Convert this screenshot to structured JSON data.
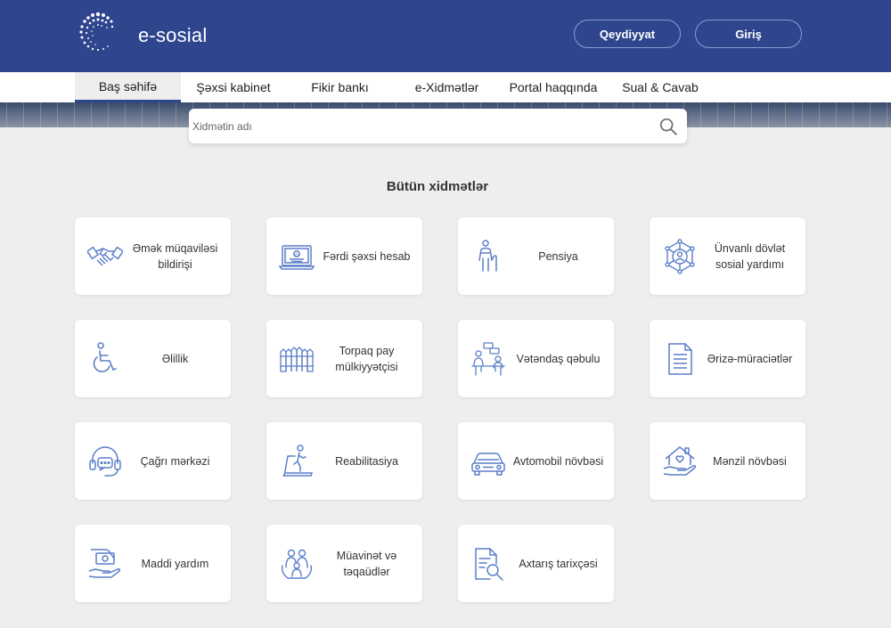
{
  "header": {
    "brand": "e-sosial",
    "register_label": "Qeydiyyat",
    "login_label": "Giriş"
  },
  "nav": {
    "items": [
      {
        "label": "Baş səhifə",
        "active": true
      },
      {
        "label": "Şəxsi kabinet"
      },
      {
        "label": "Fikir bankı"
      },
      {
        "label": "e-Xidmətlər"
      },
      {
        "label": "Portal haqqında"
      },
      {
        "label": "Sual & Cavab"
      }
    ]
  },
  "search": {
    "placeholder": "Xidmətin adı",
    "icon": "search-icon"
  },
  "services": {
    "title": "Bütün xidmətlər",
    "items": [
      {
        "label": "Əmək müqaviləsi bildirişi",
        "icon": "handshake-icon"
      },
      {
        "label": "Fərdi şəxsi hesab",
        "icon": "laptop-icon"
      },
      {
        "label": "Pensiya",
        "icon": "elderly-icon"
      },
      {
        "label": "Ünvanlı dövlət sosial yardımı",
        "icon": "network-person-icon"
      },
      {
        "label": "Əlillik",
        "icon": "wheelchair-icon"
      },
      {
        "label": "Torpaq pay mülkiyyətçisi",
        "icon": "fence-icon"
      },
      {
        "label": "Vətəndaş qəbulu",
        "icon": "meeting-icon"
      },
      {
        "label": "Ərizə-müraciətlər",
        "icon": "document-icon"
      },
      {
        "label": "Çağrı mərkəzi",
        "icon": "headset-icon"
      },
      {
        "label": "Reabilitasiya",
        "icon": "treadmill-icon"
      },
      {
        "label": "Avtomobil növbəsi",
        "icon": "car-icon"
      },
      {
        "label": "Mənzil növbəsi",
        "icon": "house-hand-icon"
      },
      {
        "label": "Maddi yardım",
        "icon": "money-hand-icon"
      },
      {
        "label": "Müavinət və təqaüdlər",
        "icon": "family-icon"
      },
      {
        "label": "Axtarış tarixçəsi",
        "icon": "search-history-icon"
      }
    ]
  },
  "colors": {
    "header_bg": "#2f468f",
    "icon_blue": "#5b7fc8",
    "page_bg": "#eeeeef"
  }
}
